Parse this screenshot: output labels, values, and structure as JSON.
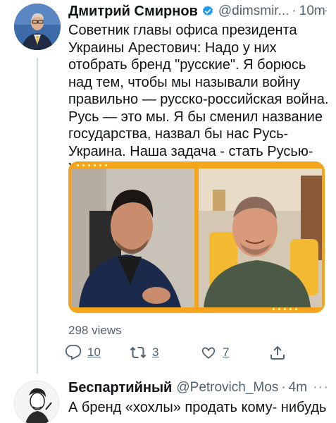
{
  "main_tweet": {
    "author_name": "Дмитрий Смирнов",
    "handle": "@dimsmir...",
    "separator": "·",
    "time": "10m",
    "more_icon": "···",
    "text": "Советник главы офиса президента Украины Арестович: Надо у них отобрать бренд \"русские\". Я борюсь над тем, чтобы мы называли войну правильно — русско-российская война. Русь — это мы. Я бы сменил название государства, назвал бы нас Русь-Украина. Наша задача - стать Русью-Украиной.",
    "views": "298 views",
    "actions": {
      "reply_count": "10",
      "retweet_count": "3",
      "like_count": "7"
    },
    "icons": {
      "verified": "verified-badge-icon",
      "reply": "reply-bubble-icon",
      "retweet": "retweet-icon",
      "like": "heart-icon",
      "share": "share-icon"
    },
    "colors": {
      "verified": "#1d9bf0",
      "media_frame": "#f4a51c"
    }
  },
  "reply_tweet": {
    "author_name": "Беспартийный",
    "handle": "@Petrovich_Mos",
    "separator": "·",
    "time": "4m",
    "more_icon": "···",
    "text": "А бренд «хохлы» продать кому- нибудь"
  }
}
